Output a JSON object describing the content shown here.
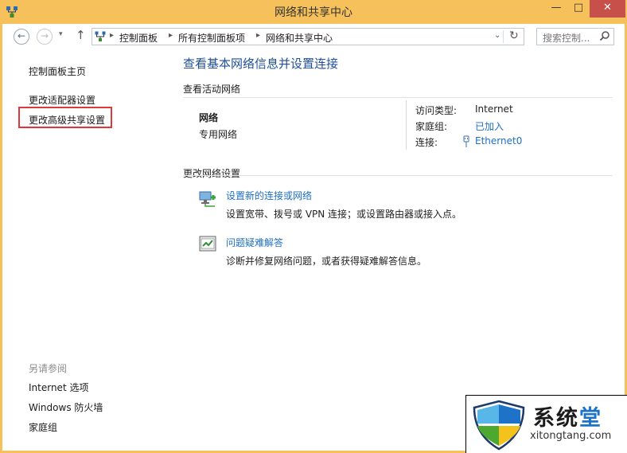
{
  "window": {
    "title": "网络和共享中心",
    "minimize_glyph": "—",
    "maximize_glyph": "□",
    "close_glyph": "✕",
    "icon": "network-center-icon"
  },
  "nav": {
    "back_glyph": "←",
    "forward_glyph": "→",
    "dropdown_glyph": "▾",
    "up_glyph": "↑",
    "breadcrumb": [
      "控制面板",
      "所有控制面板项",
      "网络和共享中心"
    ],
    "separator_glyph": "▸",
    "address_dropdown_glyph": "⌄",
    "refresh_glyph": "↻",
    "search_placeholder": "搜索控制..."
  },
  "sidebar": {
    "home": "控制面板主页",
    "links": [
      "更改适配器设置",
      "更改高级共享设置"
    ],
    "selected_index": 1,
    "see_also_heading": "另请参阅",
    "see_also": [
      "Internet 选项",
      "Windows 防火墙",
      "家庭组"
    ]
  },
  "main": {
    "title": "查看基本网络信息并设置连接",
    "active_heading": "查看活动网络",
    "network": {
      "name": "网络",
      "category": "专用网络",
      "access_type_label": "访问类型:",
      "access_type_value": "Internet",
      "homegroup_label": "家庭组:",
      "homegroup_value": "已加入",
      "connection_label": "连接:",
      "connection_value": "Ethernet0"
    },
    "change_heading": "更改网络设置",
    "tasks": [
      {
        "link": "设置新的连接或网络",
        "desc": "设置宽带、拨号或 VPN 连接；或设置路由器或接入点。",
        "icon": "new-connection-icon"
      },
      {
        "link": "问题疑难解答",
        "desc": "诊断并修复网络问题，或者获得疑难解答信息。",
        "icon": "troubleshoot-icon"
      }
    ]
  },
  "watermark": {
    "title_part1": "系统",
    "title_part2": "堂",
    "url": "xitongtang.com"
  },
  "colors": {
    "titlebar": "#f6c15a",
    "link": "#1e6fc5",
    "heading": "#1e4e9c",
    "highlight_border": "#e0383a",
    "close_button": "#c7504b"
  }
}
